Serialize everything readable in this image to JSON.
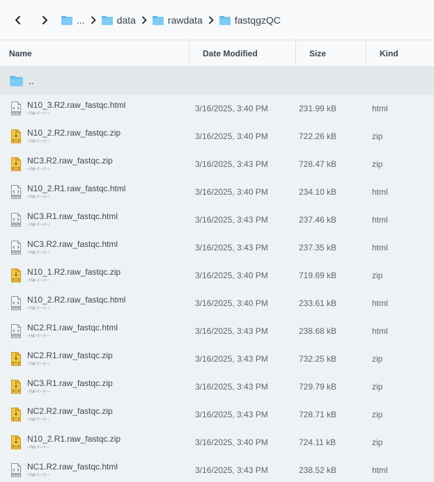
{
  "toolbar": {
    "breadcrumb": [
      "...",
      "data",
      "rawdata",
      "fastqgzQC"
    ]
  },
  "table": {
    "columns": {
      "name": "Name",
      "date": "Date Modified",
      "size": "Size",
      "kind": "Kind"
    },
    "parent_label": "..",
    "rows": [
      {
        "name": "N10_3.R2.raw_fastqc.html",
        "perm": "-rw-r--r--",
        "date": "3/16/2025, 3:40 PM",
        "size": "231.99 kB",
        "kind": "html",
        "icon": "html-file-icon"
      },
      {
        "name": "N10_2.R2.raw_fastqc.zip",
        "perm": "-rw-r--r--",
        "date": "3/16/2025, 3:40 PM",
        "size": "722.26 kB",
        "kind": "zip",
        "icon": "zip-file-icon"
      },
      {
        "name": "NC3.R2.raw_fastqc.zip",
        "perm": "-rw-r--r--",
        "date": "3/16/2025, 3:43 PM",
        "size": "728.47 kB",
        "kind": "zip",
        "icon": "zip-file-icon"
      },
      {
        "name": "N10_2.R1.raw_fastqc.html",
        "perm": "-rw-r--r--",
        "date": "3/16/2025, 3:40 PM",
        "size": "234.10 kB",
        "kind": "html",
        "icon": "html-file-icon"
      },
      {
        "name": "NC3.R1.raw_fastqc.html",
        "perm": "-rw-r--r--",
        "date": "3/16/2025, 3:43 PM",
        "size": "237.46 kB",
        "kind": "html",
        "icon": "html-file-icon"
      },
      {
        "name": "NC3.R2.raw_fastqc.html",
        "perm": "-rw-r--r--",
        "date": "3/16/2025, 3:43 PM",
        "size": "237.35 kB",
        "kind": "html",
        "icon": "html-file-icon"
      },
      {
        "name": "N10_1.R2.raw_fastqc.zip",
        "perm": "-rw-r--r--",
        "date": "3/16/2025, 3:40 PM",
        "size": "719.69 kB",
        "kind": "zip",
        "icon": "zip-file-icon"
      },
      {
        "name": "N10_2.R2.raw_fastqc.html",
        "perm": "-rw-r--r--",
        "date": "3/16/2025, 3:40 PM",
        "size": "233.61 kB",
        "kind": "html",
        "icon": "html-file-icon"
      },
      {
        "name": "NC2.R1.raw_fastqc.html",
        "perm": "-rw-r--r--",
        "date": "3/16/2025, 3:43 PM",
        "size": "238.68 kB",
        "kind": "html",
        "icon": "html-file-icon"
      },
      {
        "name": "NC2.R1.raw_fastqc.zip",
        "perm": "-rw-r--r--",
        "date": "3/16/2025, 3:43 PM",
        "size": "732.25 kB",
        "kind": "zip",
        "icon": "zip-file-icon"
      },
      {
        "name": "NC3.R1.raw_fastqc.zip",
        "perm": "-rw-r--r--",
        "date": "3/16/2025, 3:43 PM",
        "size": "729.79 kB",
        "kind": "zip",
        "icon": "zip-file-icon"
      },
      {
        "name": "NC2.R2.raw_fastqc.zip",
        "perm": "-rw-r--r--",
        "date": "3/16/2025, 3:43 PM",
        "size": "728.71 kB",
        "kind": "zip",
        "icon": "zip-file-icon"
      },
      {
        "name": "N10_2.R1.raw_fastqc.zip",
        "perm": "-rw-r--r--",
        "date": "3/16/2025, 3:40 PM",
        "size": "724.11 kB",
        "kind": "zip",
        "icon": "zip-file-icon"
      },
      {
        "name": "NC1.R2.raw_fastqc.html",
        "perm": "-rw-r--r--",
        "date": "3/16/2025, 3:43 PM",
        "size": "238.52 kB",
        "kind": "html",
        "icon": "html-file-icon"
      }
    ]
  },
  "colors": {
    "folder": "#5bb8ee",
    "zip_icon": "#e8b92f",
    "html_icon": "#8a959e"
  }
}
